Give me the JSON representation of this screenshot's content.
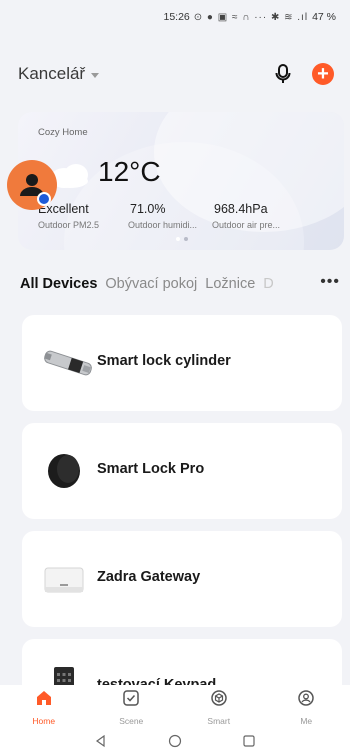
{
  "status_bar": {
    "time": "15:26",
    "icons": "⊙ ● ▣ ≈ ∩ ··· ✱ ≋ .ıl",
    "battery": "47 %"
  },
  "header": {
    "home_name": "Kancelář"
  },
  "weather": {
    "home_label": "Cozy Home",
    "temperature": "12°C",
    "pm25_value": "Excellent",
    "pm25_label": "Outdoor PM2.5",
    "humidity_value": "71.0%",
    "humidity_label": "Outdoor humidi...",
    "pressure_value": "968.4hPa",
    "pressure_label": "Outdoor air pre..."
  },
  "tabs": [
    {
      "label": "All Devices"
    },
    {
      "label": "Obývací pokoj"
    },
    {
      "label": "Ložnice"
    },
    {
      "label": "D"
    }
  ],
  "devices": [
    {
      "name": "Smart lock cylinder",
      "icon": "lock-cylinder-icon"
    },
    {
      "name": "Smart Lock Pro",
      "icon": "smart-lock-pro-icon"
    },
    {
      "name": "Zadra Gateway",
      "icon": "gateway-icon"
    },
    {
      "name": "testovací Keypad",
      "icon": "keypad-icon"
    }
  ],
  "bottom_nav": [
    {
      "label": "Home",
      "icon": "home-icon",
      "active": true
    },
    {
      "label": "Scene",
      "icon": "scene-icon",
      "active": false
    },
    {
      "label": "Smart",
      "icon": "smart-icon",
      "active": false
    },
    {
      "label": "Me",
      "icon": "me-icon",
      "active": false
    }
  ],
  "colors": {
    "accent": "#ff5a28",
    "background": "#f2f3f7",
    "card": "#ffffff"
  }
}
